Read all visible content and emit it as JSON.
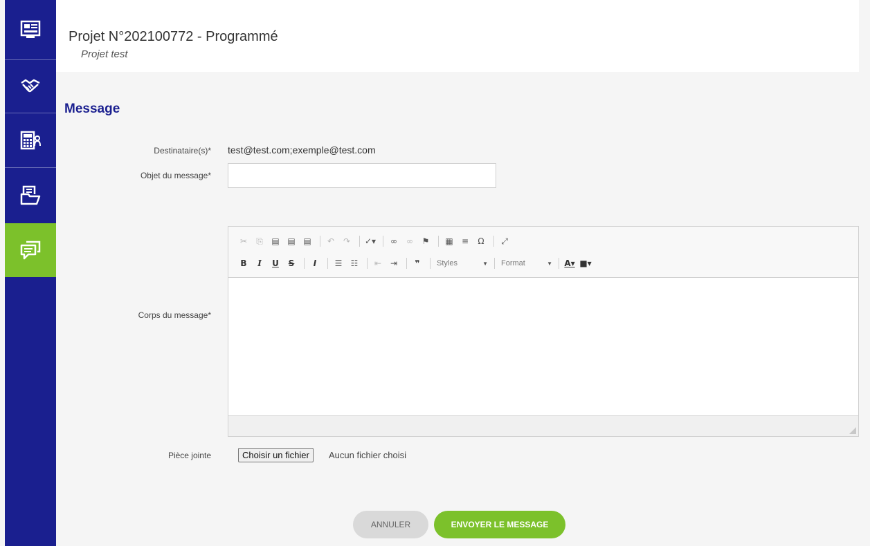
{
  "sidebar": {
    "items": [
      {
        "icon": "id-card-icon",
        "active": false
      },
      {
        "icon": "handshake-icon",
        "active": false
      },
      {
        "icon": "calculator-person-icon",
        "active": false
      },
      {
        "icon": "folder-documents-icon",
        "active": false
      },
      {
        "icon": "chat-message-icon",
        "active": true
      }
    ],
    "colors": {
      "background": "#1a1f8f",
      "active": "#7cc12b"
    }
  },
  "header": {
    "title": "Projet N°202100772 - Programmé",
    "subtitle": "Projet test"
  },
  "main": {
    "section_title": "Message",
    "fields": {
      "recipients_label": "Destinataire(s)*",
      "recipients_value": "test@test.com;exemple@test.com",
      "subject_label": "Objet du message*",
      "subject_value": "",
      "body_label": "Corps du message*",
      "attachment_label": "Pièce jointe",
      "file_button": "Choisir un fichier",
      "file_status": "Aucun fichier choisi"
    },
    "editor": {
      "styles_label": "Styles",
      "format_label": "Format"
    },
    "buttons": {
      "cancel": "ANNULER",
      "send": "ENVOYER LE MESSAGE"
    }
  }
}
